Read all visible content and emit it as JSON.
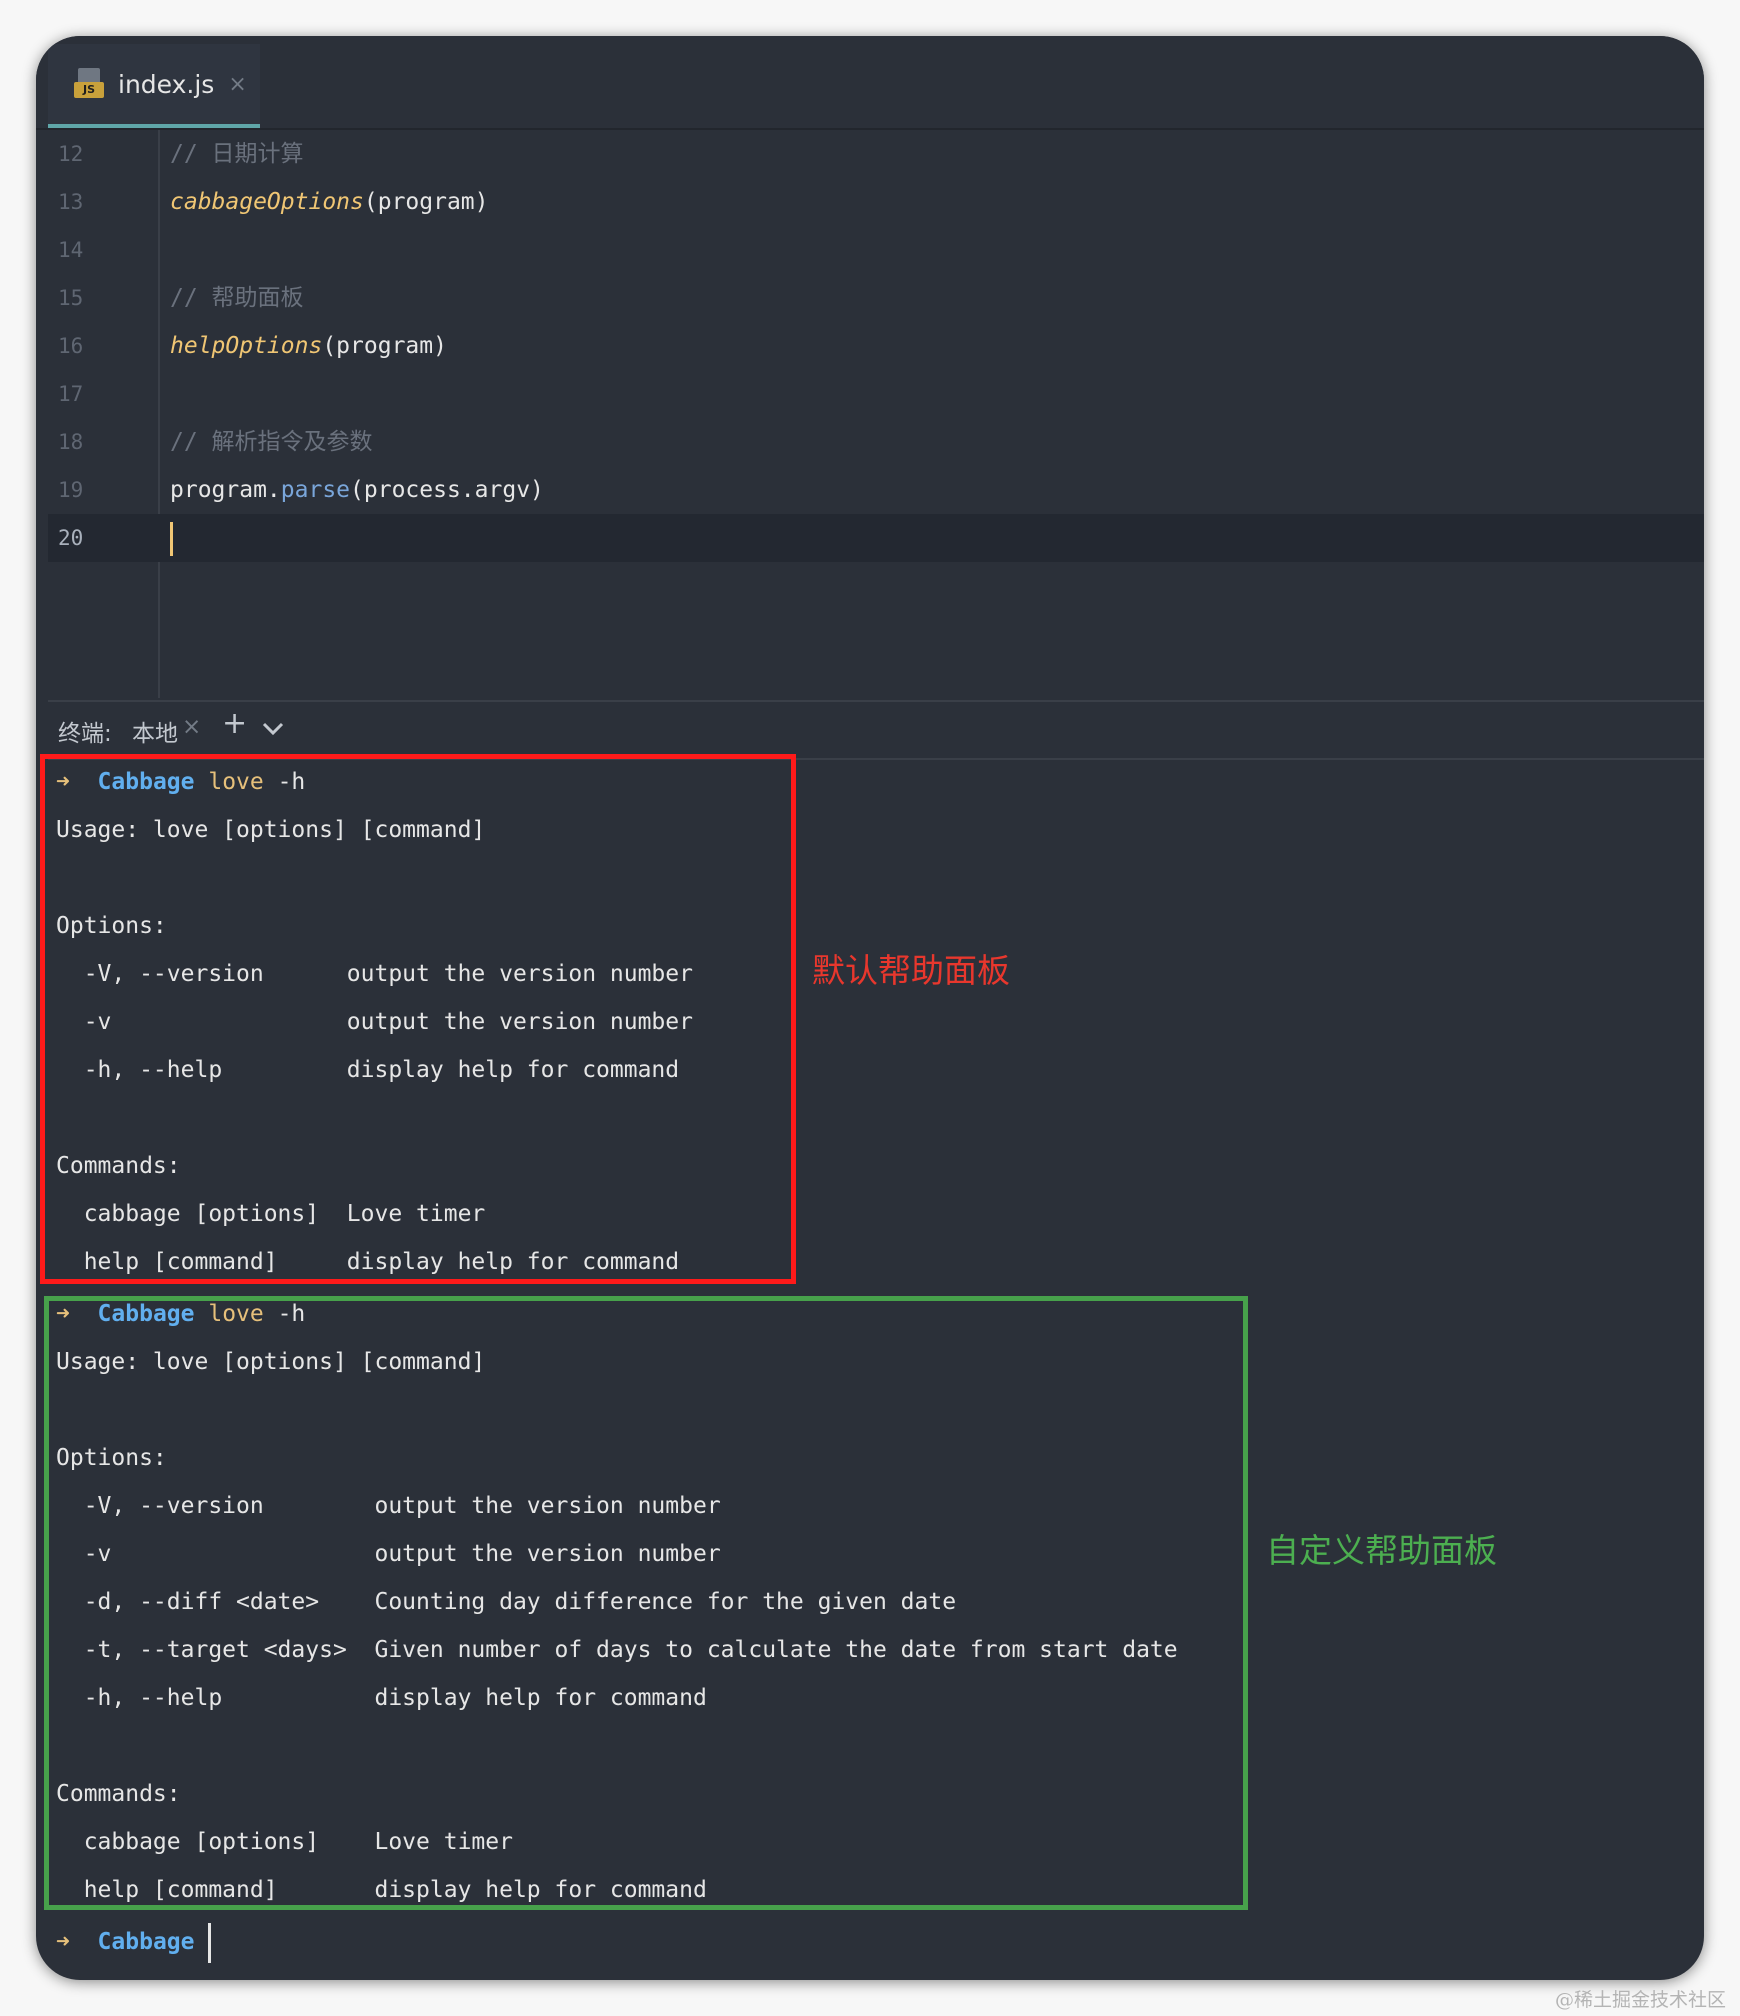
{
  "tab": {
    "label": "index.js",
    "icon": "js-file-icon",
    "close": "×"
  },
  "editor": {
    "lines": [
      {
        "num": "12",
        "parts": [
          {
            "t": "// 日期计算",
            "c": "c-comment"
          }
        ]
      },
      {
        "num": "13",
        "parts": [
          {
            "t": "cabbageOptions",
            "c": "c-fn"
          },
          {
            "t": "(program)",
            "c": "c-plain"
          }
        ]
      },
      {
        "num": "14",
        "parts": []
      },
      {
        "num": "15",
        "parts": [
          {
            "t": "// 帮助面板",
            "c": "c-comment"
          }
        ]
      },
      {
        "num": "16",
        "parts": [
          {
            "t": "helpOptions",
            "c": "c-fn"
          },
          {
            "t": "(program)",
            "c": "c-plain"
          }
        ]
      },
      {
        "num": "17",
        "parts": []
      },
      {
        "num": "18",
        "parts": [
          {
            "t": "// 解析指令及参数",
            "c": "c-comment"
          }
        ]
      },
      {
        "num": "19",
        "parts": [
          {
            "t": "program.",
            "c": "c-plain"
          },
          {
            "t": "parse",
            "c": "c-method"
          },
          {
            "t": "(process.argv)",
            "c": "c-plain"
          }
        ]
      },
      {
        "num": "20",
        "parts": [],
        "current": true
      }
    ]
  },
  "terminal_header": {
    "label": "终端:",
    "tab": "本地",
    "close": "×",
    "add": "+",
    "dropdown": "⌄"
  },
  "terminal": {
    "block1": [
      {
        "prompt": true,
        "arrow": "➜",
        "dir": "Cabbage",
        "cmd": "love",
        "args": " -h"
      },
      {
        "text": "Usage: love [options] [command]"
      },
      {
        "text": ""
      },
      {
        "text": "Options:"
      },
      {
        "text": "  -V, --version      output the version number"
      },
      {
        "text": "  -v                 output the version number"
      },
      {
        "text": "  -h, --help         display help for command"
      },
      {
        "text": ""
      },
      {
        "text": "Commands:"
      },
      {
        "text": "  cabbage [options]  Love timer"
      },
      {
        "text": "  help [command]     display help for command"
      }
    ],
    "block2": [
      {
        "prompt": true,
        "arrow": "➜",
        "dir": "Cabbage",
        "cmd": "love",
        "args": " -h"
      },
      {
        "text": "Usage: love [options] [command]"
      },
      {
        "text": ""
      },
      {
        "text": "Options:"
      },
      {
        "text": "  -V, --version        output the version number"
      },
      {
        "text": "  -v                   output the version number"
      },
      {
        "text": "  -d, --diff <date>    Counting day difference for the given date"
      },
      {
        "text": "  -t, --target <days>  Given number of days to calculate the date from start date"
      },
      {
        "text": "  -h, --help           display help for command"
      },
      {
        "text": ""
      },
      {
        "text": "Commands:"
      },
      {
        "text": "  cabbage [options]    Love timer"
      },
      {
        "text": "  help [command]       display help for command"
      }
    ],
    "final_prompt": {
      "arrow": "➜",
      "dir": "Cabbage"
    }
  },
  "annotations": {
    "default_help": "默认帮助面板",
    "custom_help": "自定义帮助面板"
  },
  "colors": {
    "red_box": "#ff1a1a",
    "green_box": "#47a14b",
    "accent": "#f0c674"
  },
  "watermark": "@稀土掘金技术社区"
}
